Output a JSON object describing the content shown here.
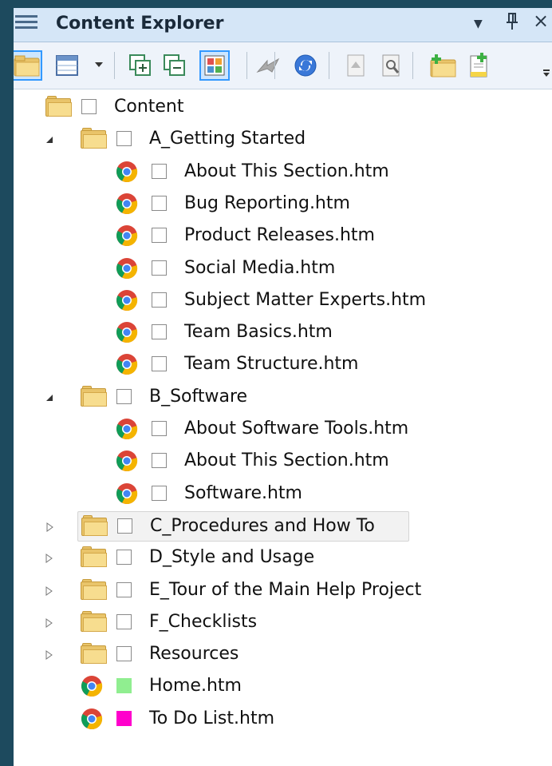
{
  "panel": {
    "title": "Content Explorer",
    "dropdown_icon": "chevron-down-icon",
    "pin_icon": "pin-icon",
    "close_icon": "close-icon",
    "pin_glyph": "Ȩ",
    "close_glyph": "×",
    "dropdown_glyph": "▼"
  },
  "toolbar": {
    "buttons": [
      {
        "name": "open-folder-button",
        "icon": "folder-icon",
        "selected": true
      },
      {
        "name": "view-layout-button",
        "icon": "grid-icon",
        "selected": false
      },
      {
        "name": "view-layout-dropdown",
        "icon": "chevron-down-icon",
        "selected": false
      },
      {
        "name": "expand-all-button",
        "icon": "expand-all-icon",
        "selected": false
      },
      {
        "name": "collapse-all-button",
        "icon": "collapse-all-icon",
        "selected": false
      },
      {
        "name": "show-status-button",
        "icon": "color-grid-icon",
        "selected": true
      },
      {
        "name": "move-button",
        "icon": "arrow-icon",
        "selected": false
      },
      {
        "name": "sync-button",
        "icon": "sync-icon",
        "selected": false
      },
      {
        "name": "properties-button",
        "icon": "document-arrow-icon",
        "selected": false
      },
      {
        "name": "search-doc-button",
        "icon": "document-search-icon",
        "selected": false
      },
      {
        "name": "new-folder-button",
        "icon": "new-folder-icon",
        "selected": false
      },
      {
        "name": "new-file-button",
        "icon": "new-file-icon",
        "selected": false
      }
    ]
  },
  "tree": {
    "items": [
      {
        "label": "Content",
        "type": "folder",
        "expanded": null,
        "level": 0
      },
      {
        "label": "A_Getting Started",
        "type": "folder",
        "expanded": true,
        "level": 1
      },
      {
        "label": "About This Section.htm",
        "type": "file",
        "level": 2
      },
      {
        "label": "Bug Reporting.htm",
        "type": "file",
        "level": 2
      },
      {
        "label": "Product Releases.htm",
        "type": "file",
        "level": 2
      },
      {
        "label": "Social Media.htm",
        "type": "file",
        "level": 2
      },
      {
        "label": "Subject Matter Experts.htm",
        "type": "file",
        "level": 2
      },
      {
        "label": "Team Basics.htm",
        "type": "file",
        "level": 2
      },
      {
        "label": "Team Structure.htm",
        "type": "file",
        "level": 2
      },
      {
        "label": "B_Software",
        "type": "folder",
        "expanded": true,
        "level": 1
      },
      {
        "label": "About Software Tools.htm",
        "type": "file",
        "level": 2
      },
      {
        "label": "About This Section.htm",
        "type": "file",
        "level": 2
      },
      {
        "label": "Software.htm",
        "type": "file",
        "level": 2
      },
      {
        "label": "C_Procedures and How To",
        "type": "folder",
        "expanded": false,
        "level": 1,
        "highlighted": true
      },
      {
        "label": "D_Style and Usage",
        "type": "folder",
        "expanded": false,
        "level": 1
      },
      {
        "label": "E_Tour of the Main Help Project",
        "type": "folder",
        "expanded": false,
        "level": 1
      },
      {
        "label": "F_Checklists",
        "type": "folder",
        "expanded": false,
        "level": 1
      },
      {
        "label": "Resources",
        "type": "folder",
        "expanded": false,
        "level": 1
      },
      {
        "label": "Home.htm",
        "type": "file",
        "level": 1,
        "status_color": "#90ee90"
      },
      {
        "label": "To Do List.htm",
        "type": "file",
        "level": 1,
        "status_color": "#ff00cc"
      }
    ]
  },
  "colors": {
    "background": "#1d4a5e",
    "titlebar": "#d5e6f7",
    "selection_border": "#3399ff"
  }
}
